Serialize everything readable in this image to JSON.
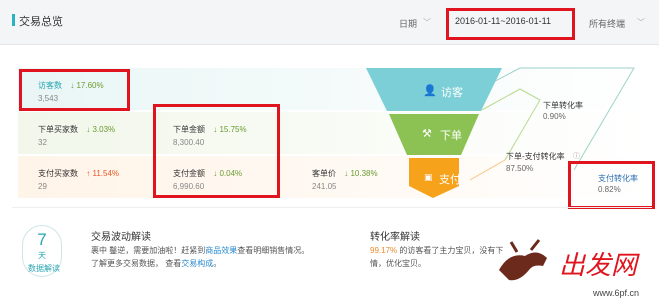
{
  "header": {
    "title": "交易总览",
    "date_label": "日期",
    "date_range": "2016-01-11~2016-01-11",
    "terminal": "所有终端"
  },
  "metrics": {
    "visitors": {
      "label": "访客数",
      "change": "17.60%",
      "direction": "down",
      "value": "3,543"
    },
    "order_buyers": {
      "label": "下单买家数",
      "change": "3.03%",
      "direction": "down",
      "value": "32"
    },
    "order_amount": {
      "label": "下单金额",
      "change": "15.75%",
      "direction": "down",
      "value": "8,300.40"
    },
    "pay_buyers": {
      "label": "支付买家数",
      "change": "11.54%",
      "direction": "up",
      "value": "29"
    },
    "pay_amount": {
      "label": "支付金额",
      "change": "0.04%",
      "direction": "down",
      "value": "6,990.60"
    },
    "unit_price": {
      "label": "客单价",
      "change": "10.38%",
      "direction": "down",
      "value": "241.05"
    }
  },
  "funnel": {
    "visit": "访客",
    "order": "下单",
    "pay": "支付",
    "colors": {
      "visit": "#7ccfd6",
      "order": "#8cc153",
      "pay": "#f7a21b"
    }
  },
  "rates": {
    "order_rate": {
      "label": "下单转化率",
      "value": "0.90%"
    },
    "order_pay_rate": {
      "label": "下单-支付转化率",
      "value": "87.50%"
    },
    "pay_rate": {
      "label": "支付转化率",
      "value": "0.82%"
    }
  },
  "wave": {
    "badge_num": "7",
    "badge_unit": "天",
    "badge_sub": "数据解读",
    "title": "交易波动解读",
    "line1_a": "裹中 鑿逆，需要加油啦！赶紧到",
    "line1_link": "商品效果",
    "line1_b": "查看明细销售情况。",
    "line2_a": "了解更多交易数据，  查看",
    "line2_link": "交易构成",
    "line2_b": "。"
  },
  "conversion": {
    "title": "转化率解读",
    "pct": "99.17%",
    "line1": "的访客看了主力宝贝，没有下",
    "line2": "情，优化宝贝。"
  },
  "watermark": {
    "text": "出发网",
    "url": "www.6pf.cn"
  }
}
